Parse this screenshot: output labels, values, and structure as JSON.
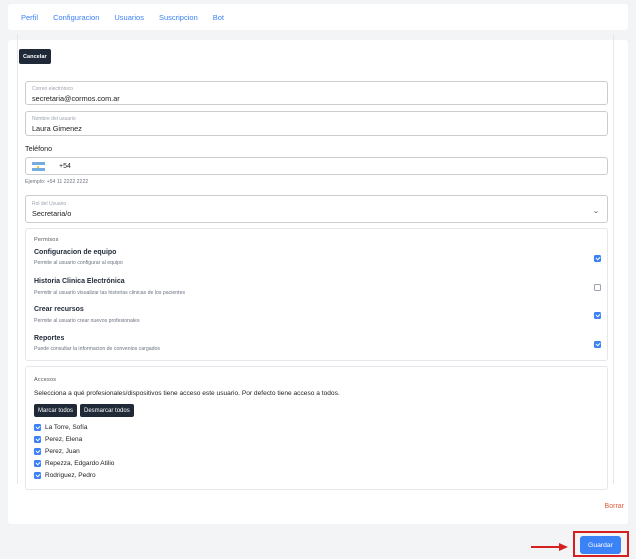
{
  "nav": {
    "tabs": [
      "Perfil",
      "Configuracion",
      "Usuarios",
      "Suscripcion",
      "Bot"
    ]
  },
  "form": {
    "cancel_label": "Cancelar",
    "email": {
      "label": "Correo electrónico",
      "value": "secretaria@cormos.com.ar"
    },
    "name": {
      "label": "Nombre del usuario",
      "value": "Laura Gimenez"
    },
    "phone": {
      "label": "Teléfono",
      "dial_code": "+54",
      "example": "Ejemplo: +54 11 2222 2222",
      "flag_icon": "argentina-flag-icon"
    },
    "role": {
      "label": "Rol del Usuario",
      "value": "Secretaria/o"
    }
  },
  "permissions": {
    "title": "Permisos",
    "items": [
      {
        "title": "Configuracion de equipo",
        "desc": "Permite al usuario configurar al equipo",
        "checked": true
      },
      {
        "title": "Historia Clinica Electrónica",
        "desc": "Permitir al usuario visualizar las historias clinicas de los pacientes",
        "checked": false
      },
      {
        "title": "Crear recursos",
        "desc": "Permite al usuario crear nuevos profesionales",
        "checked": true
      },
      {
        "title": "Reportes",
        "desc": "Puede consultar la informacion de convenios cargados",
        "checked": true
      }
    ]
  },
  "access": {
    "title": "Accesos",
    "description": "Selecciona a qué profesionales/dispositivos tiene acceso este usuario. Por defecto tiene acceso a todos.",
    "select_all_label": "Marcar todos",
    "deselect_all_label": "Desmarcar todos",
    "items": [
      {
        "name": "La Torre, Sofía",
        "checked": true
      },
      {
        "name": "Perez, Elena",
        "checked": true
      },
      {
        "name": "Perez, Juan",
        "checked": true
      },
      {
        "name": "Repezza, Edgardo Atilio",
        "checked": true
      },
      {
        "name": "Rodriguez, Pedro",
        "checked": true
      }
    ]
  },
  "actions": {
    "delete_label": "Borrar",
    "save_label": "Guardar"
  },
  "colors": {
    "accent": "#3b82f6",
    "annotation": "#d61f1f",
    "danger": "#e35d3c"
  }
}
